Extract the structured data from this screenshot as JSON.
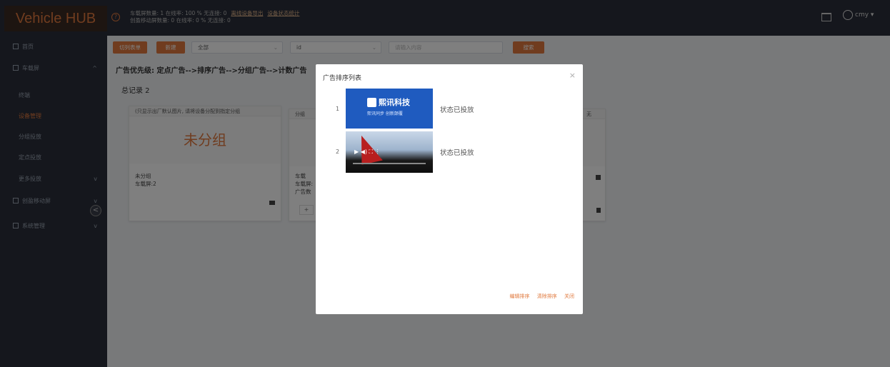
{
  "app": {
    "title": "Vehicle HUB",
    "help_symbol": "?"
  },
  "header": {
    "stats_line1": "车载屏数量: 1 在线率: 100 % 无连接: 0",
    "stats_line2": "创盈移动屏数量: 0 在线率: 0 % 无连接: 0",
    "link_export": "离线设备导出",
    "link_stats": "设备状态统计",
    "username": "cmy ▾"
  },
  "sidebar": {
    "items": [
      {
        "label": "首页",
        "chevron": ""
      },
      {
        "label": "车载屏",
        "chevron": "^"
      },
      {
        "label": "终端",
        "chevron": ""
      },
      {
        "label": "设备管理",
        "chevron": ""
      },
      {
        "label": "分组投放",
        "chevron": ""
      },
      {
        "label": "定点投放",
        "chevron": ""
      },
      {
        "label": "更多投放",
        "chevron": "v"
      },
      {
        "label": "创盈移动屏",
        "chevron": "v"
      },
      {
        "label": "系统管理",
        "chevron": "v"
      }
    ],
    "collapse_symbol": "<"
  },
  "toolbar": {
    "btn_list": "切列表单",
    "btn_new": "新建",
    "select_all": "全部",
    "select_id": "id",
    "search_placeholder": "请输入内容",
    "btn_search": "搜索"
  },
  "main": {
    "priority_text": "广告优先级: 定点广告-->排序广告-->分组广告-->计数广告",
    "total_text": "总记录 2"
  },
  "cards": [
    {
      "head": "(只显示出厂默认图片, 请将设备分配到指定分组",
      "big_label": "未分组",
      "info1": "未分组",
      "info2": "车载屏:2"
    },
    {
      "head": "分组",
      "info1": "车载",
      "info2": "车载屏:",
      "info3": "广告数",
      "plus": "+"
    },
    {
      "head": "无"
    }
  ],
  "modal": {
    "title": "广告排序列表",
    "close": "×",
    "rows": [
      {
        "num": "1",
        "status": "状态已投放",
        "brand_name": "熙讯科技",
        "brand_slogan": "熙讯同步 创新颠覆"
      },
      {
        "num": "2",
        "status": "状态已投放",
        "video_controls": "▶ ◀)  ⛶ ⋮"
      }
    ],
    "action_edit": "编辑排序",
    "action_clear": "清除排序",
    "action_close": "关闭"
  },
  "colors": {
    "accent": "#e0793e",
    "sidebar": "#2b2f3a",
    "brand_blue": "#1f5bbf"
  }
}
